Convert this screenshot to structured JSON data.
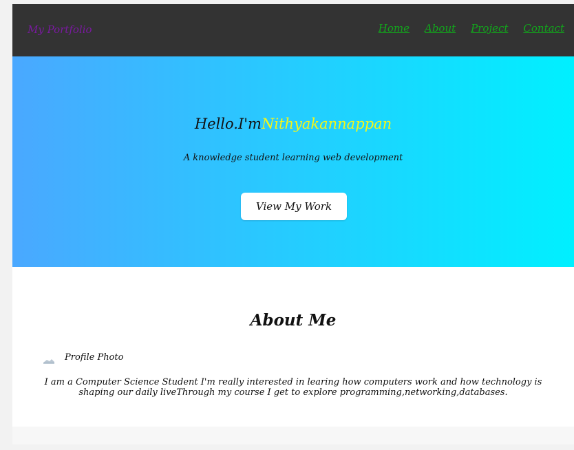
{
  "nav": {
    "brand": "My Portfolio",
    "links": [
      "Home",
      "About",
      "Project",
      "Contact"
    ]
  },
  "hero": {
    "greeting": "Hello.I'm",
    "name": "Nithyakannappan",
    "subtitle": "A knowledge student learning web development",
    "button_label": "View My Work"
  },
  "about": {
    "heading": "About Me",
    "profile_alt": "Profile Photo",
    "text": "I am a Computer Science Student I'm really interested in learing how computers work and how technology is shaping our daily liveThrough my course I get to explore programming,networking,databases."
  },
  "colors": {
    "navbar_bg": "#333333",
    "brand": "#7a1aa0",
    "nav_link": "#12a61c",
    "hero_gradient_start": "#4aa8ff",
    "hero_gradient_end": "#00f0ff",
    "hero_name": "#f4f61a"
  },
  "icons": {
    "profile_image": "broken-image-icon"
  }
}
